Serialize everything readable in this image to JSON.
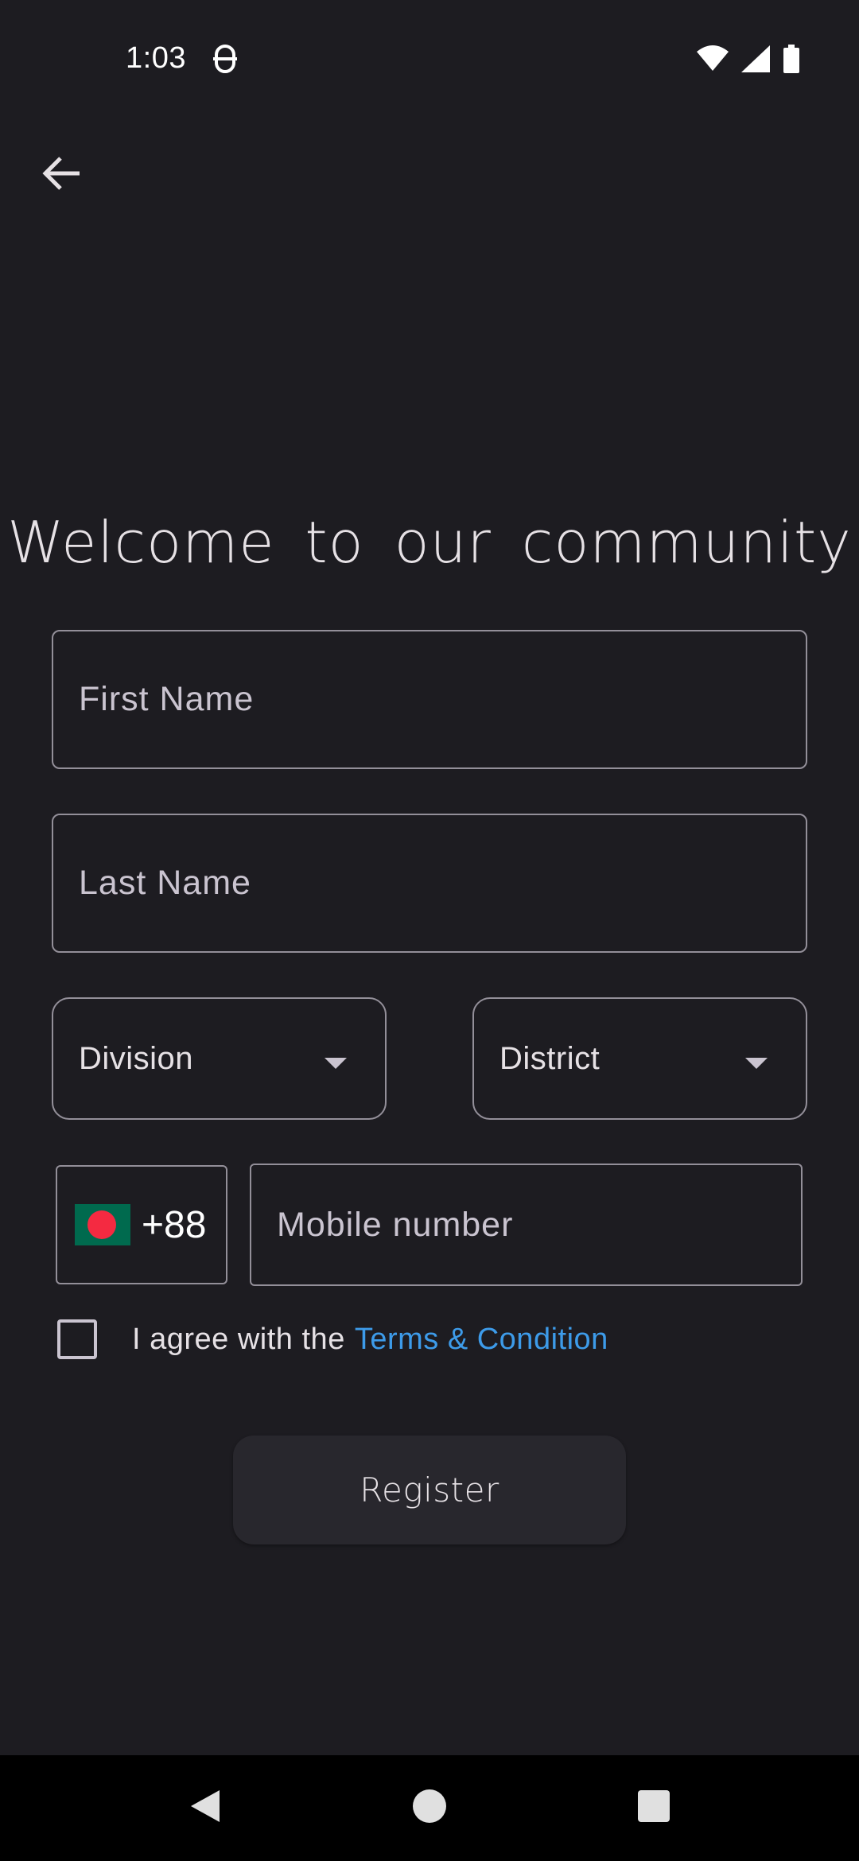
{
  "status_bar": {
    "time": "1:03",
    "icons": [
      "app-notification-icon",
      "wifi-icon",
      "cellular-signal-icon",
      "battery-icon"
    ]
  },
  "header": {
    "back_icon": "arrow-left-icon"
  },
  "title": "Welcome to our community",
  "form": {
    "first_name_placeholder": "First Name",
    "last_name_placeholder": "Last Name",
    "division_label": "Division",
    "district_label": "District",
    "country_code": "+88",
    "country_flag": "bangladesh-flag-icon",
    "mobile_placeholder": "Mobile number",
    "terms_checked": false,
    "terms_prefix": "I agree with the",
    "terms_link": "Terms & Condition",
    "register_label": "Register"
  },
  "colors": {
    "background": "#1d1c21",
    "outline": "#938f99",
    "link": "#3d9be9",
    "button_bg": "#28272d",
    "flag_green": "#006a4e",
    "flag_red": "#f42a41"
  },
  "nav_bar": {
    "icons": [
      "nav-back-icon",
      "nav-home-icon",
      "nav-recents-icon"
    ]
  }
}
